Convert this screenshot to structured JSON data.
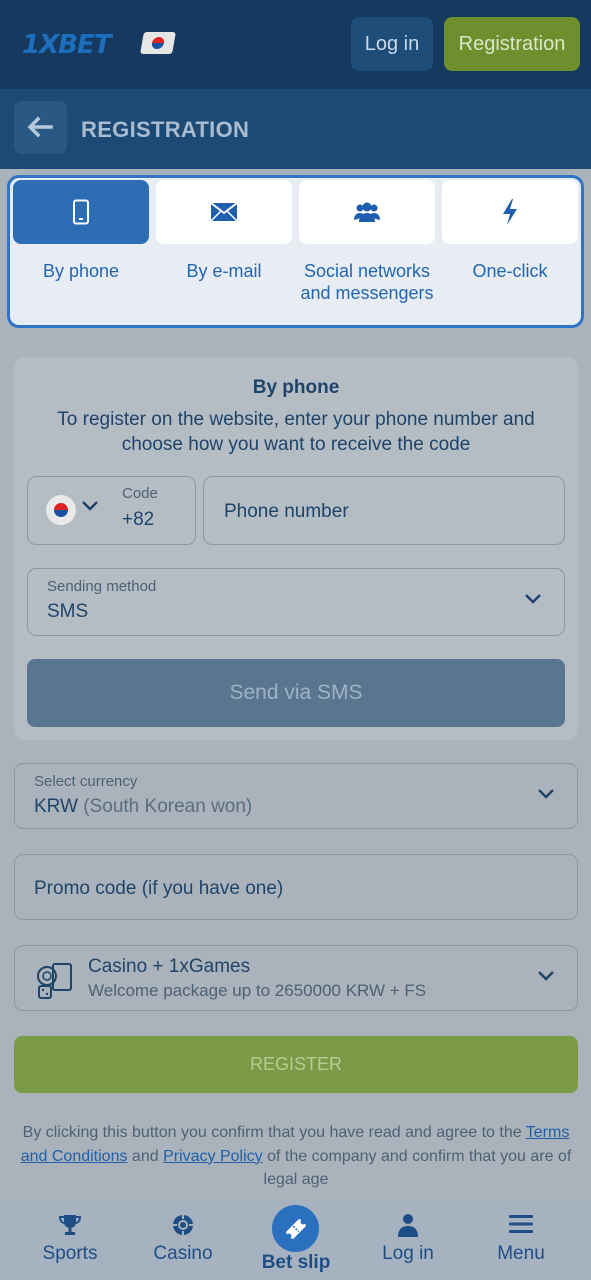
{
  "header": {
    "logo": "1XBET",
    "login_label": "Log in",
    "registration_label": "Registration"
  },
  "titlebar": {
    "title": "REGISTRATION"
  },
  "tabs": [
    {
      "label": "By phone",
      "icon": "phone-icon",
      "active": true
    },
    {
      "label": "By e-mail",
      "icon": "envelope-icon",
      "active": false
    },
    {
      "label": "Social networks and messengers",
      "icon": "users-icon",
      "active": false
    },
    {
      "label": "One-click",
      "icon": "lightning-icon",
      "active": false
    }
  ],
  "form": {
    "heading": "By phone",
    "description": "To register on the website, enter your phone number and choose how you want to receive the code",
    "code_caption": "Code",
    "code_value": "+82",
    "phone_placeholder": "Phone number",
    "method_caption": "Sending method",
    "method_value": "SMS",
    "send_button": "Send via SMS"
  },
  "currency": {
    "caption": "Select currency",
    "code": "KRW",
    "name": "(South Korean won)"
  },
  "promo": {
    "placeholder": "Promo code (if you have one)"
  },
  "bonus": {
    "title": "Casino + 1xGames",
    "subtitle": "Welcome package up to 2650000 KRW + FS"
  },
  "register_button": "REGISTER",
  "consent": {
    "before": "By clicking this button you confirm that you have read and agree to the",
    "terms_link": "Terms and Conditions",
    "and": "and",
    "privacy_link": "Privacy Policy",
    "after": "of the company and confirm that you are of legal age"
  },
  "bottom_nav": {
    "sports": "Sports",
    "casino": "Casino",
    "betslip": "Bet slip",
    "login": "Log in",
    "menu": "Menu"
  },
  "colors": {
    "header_bg": "#163a5f",
    "accent_blue": "#2c6db4",
    "registration_green": "#6e8f2e"
  }
}
